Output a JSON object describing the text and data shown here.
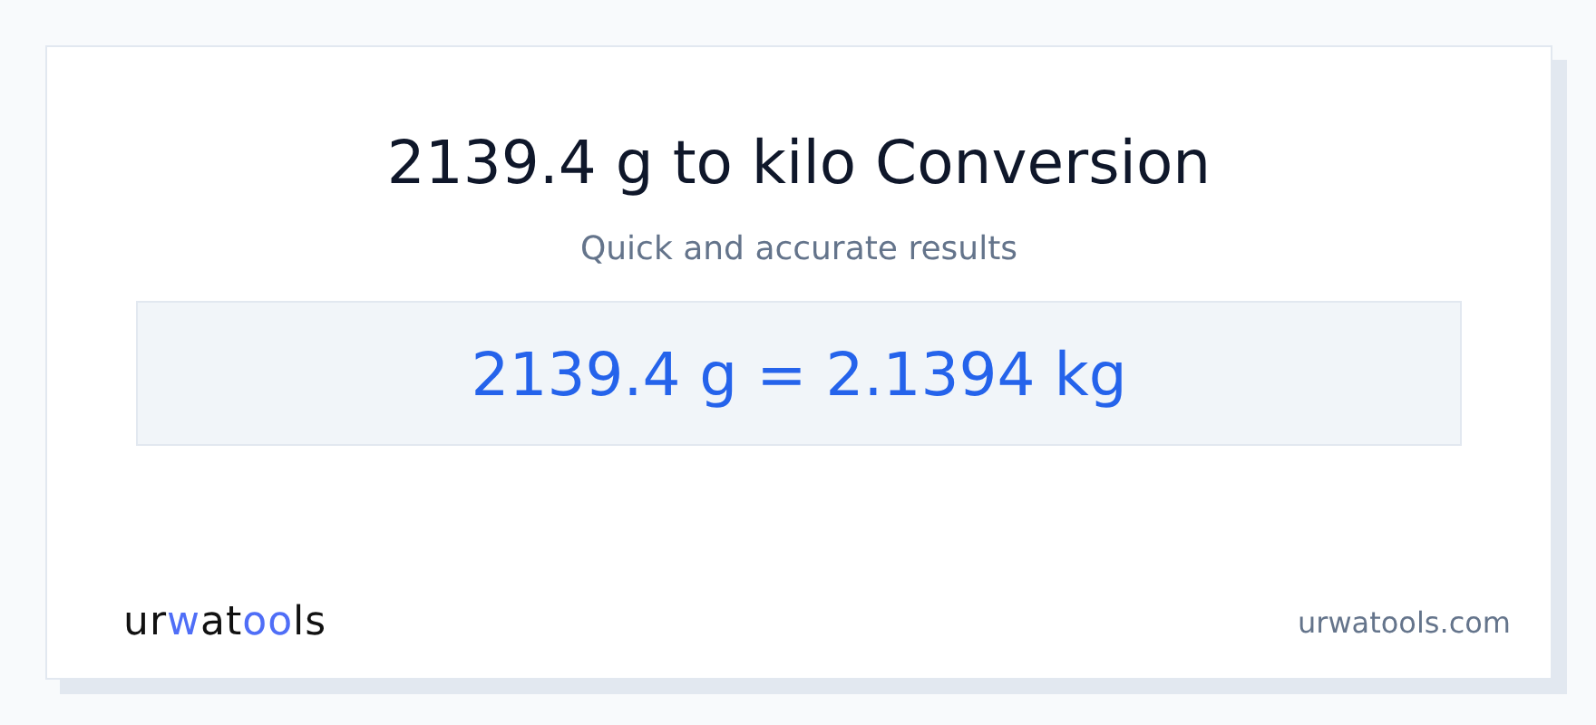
{
  "title": "2139.4 g to kilo Conversion",
  "subtitle": "Quick and accurate results",
  "result": "2139.4 g = 2.1394 kg",
  "logo": [
    {
      "text": "ur",
      "accent": false
    },
    {
      "text": "w",
      "accent": true
    },
    {
      "text": "at",
      "accent": false
    },
    {
      "text": "oo",
      "accent": true
    },
    {
      "text": "ls",
      "accent": false
    }
  ],
  "site": "urwatools.com"
}
